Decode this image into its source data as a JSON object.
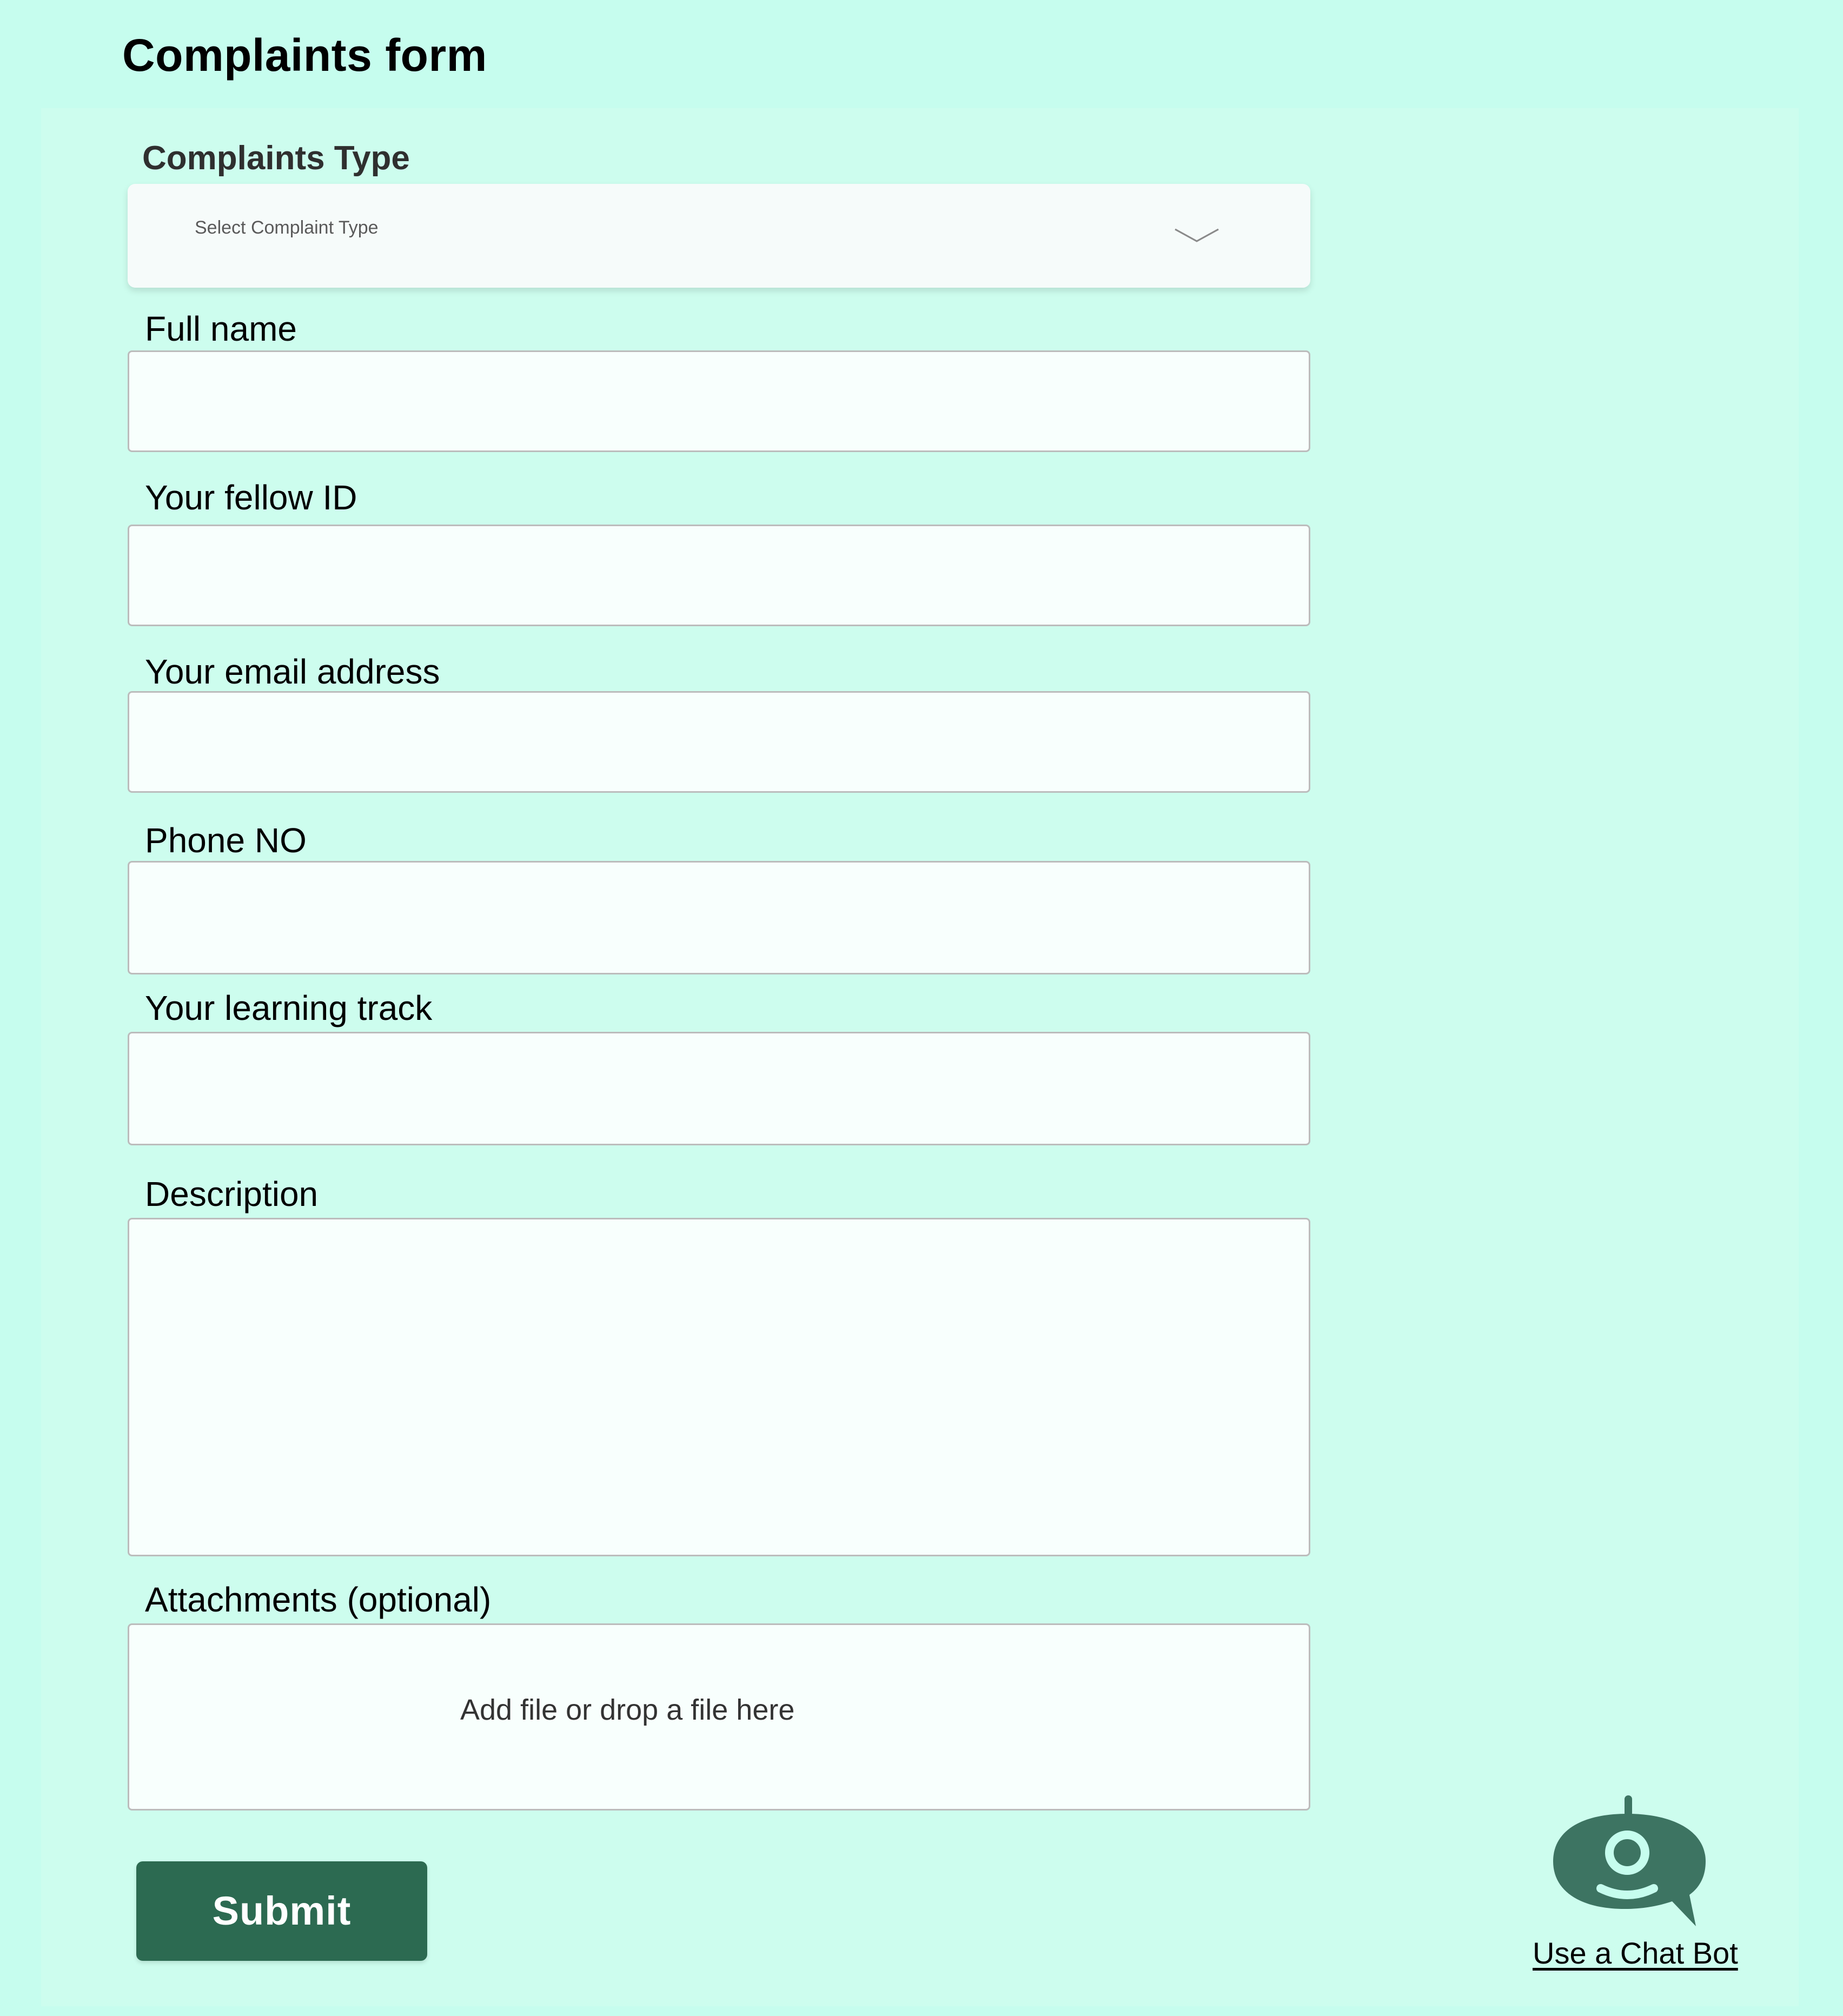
{
  "header": {
    "title": "Complaints form"
  },
  "form": {
    "complaint_type": {
      "label": "Complaints Type",
      "placeholder": "Select Complaint Type"
    },
    "full_name": {
      "label": "Full name",
      "value": ""
    },
    "fellow_id": {
      "label": "Your fellow ID",
      "value": ""
    },
    "email": {
      "label": "Your email address",
      "value": ""
    },
    "phone": {
      "label": "Phone NO",
      "value": ""
    },
    "learning_track": {
      "label": "Your learning track",
      "value": ""
    },
    "description": {
      "label": "Description",
      "value": ""
    },
    "attachments": {
      "label": "Attachments (optional)",
      "dropzone_text": "Add file or drop a file here"
    },
    "submit_label": "Submit"
  },
  "chatbot": {
    "link_text": "Use a Chat Bot",
    "icon": "chatbot-icon",
    "icon_color": "#3d7462"
  },
  "colors": {
    "background": "#c6fdee",
    "primary_button": "#2c6a51"
  }
}
